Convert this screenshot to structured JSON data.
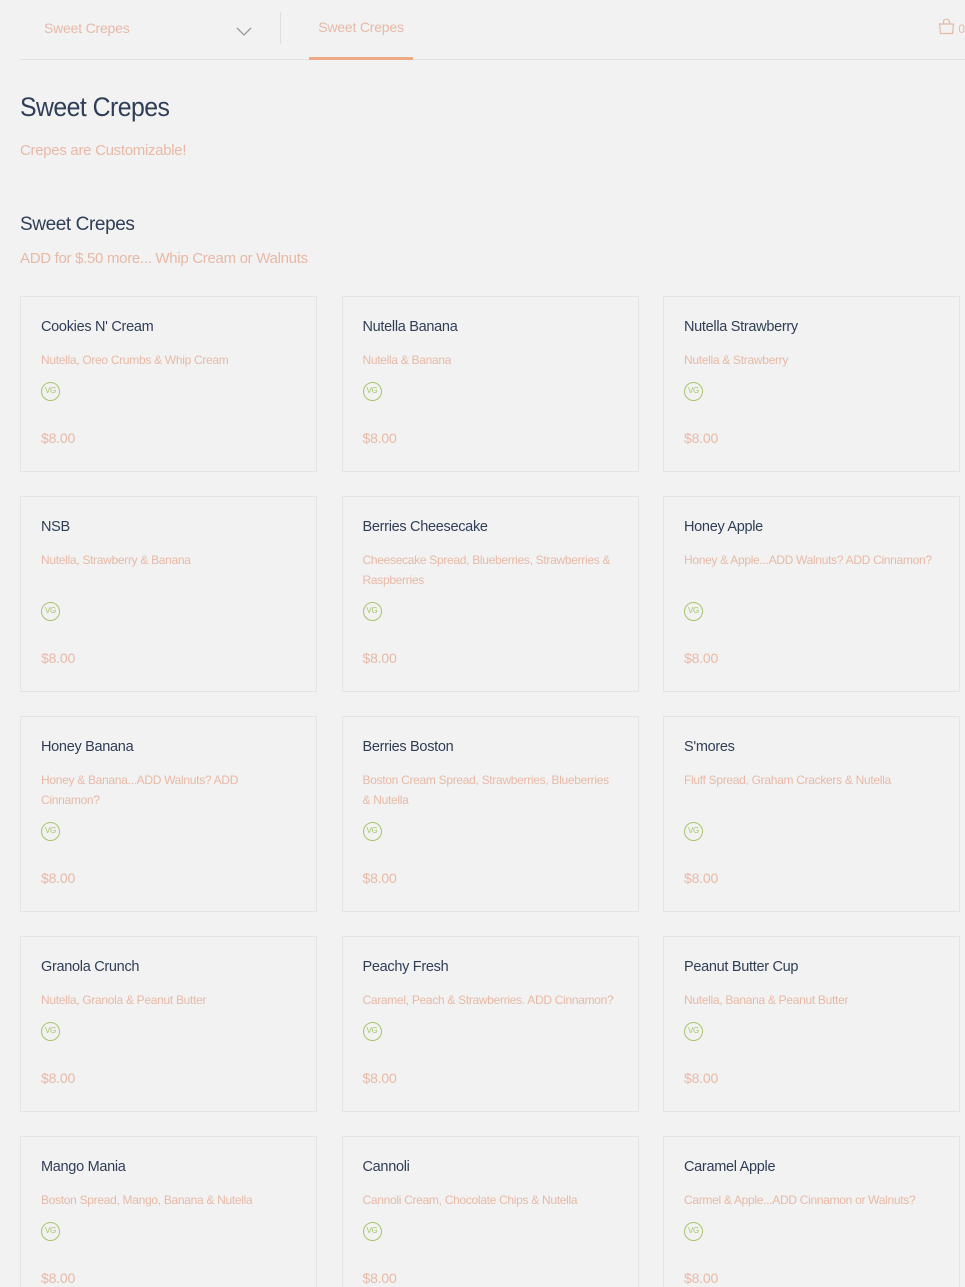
{
  "header": {
    "menu_select_label": "Sweet Crepes",
    "active_tab": "Sweet Crepes",
    "cart_count": "0"
  },
  "page": {
    "title": "Sweet Crepes",
    "subtitle": "Crepes are Customizable!"
  },
  "section": {
    "title": "Sweet Crepes",
    "subtitle": "ADD for $.50 more... Whip Cream or Walnuts"
  },
  "badge_label": "VG",
  "colors": {
    "accent": "#f0a985",
    "muted_text": "#e7b9a6",
    "heading": "#2f3e56",
    "vegetarian_badge": "#a6c46a",
    "background": "#f2f2f2"
  },
  "items": [
    {
      "name": "Cookies N' Cream",
      "description": "Nutella, Oreo Crumbs & Whip Cream",
      "price": "$8.00"
    },
    {
      "name": "Nutella Banana",
      "description": "Nutella & Banana",
      "price": "$8.00"
    },
    {
      "name": "Nutella Strawberry",
      "description": "Nutella & Strawberry",
      "price": "$8.00"
    },
    {
      "name": "NSB",
      "description": "Nutella, Strawberry & Banana",
      "price": "$8.00"
    },
    {
      "name": "Berries Cheesecake",
      "description": "Cheesecake Spread, Blueberries, Strawberries & Raspberries",
      "price": "$8.00"
    },
    {
      "name": "Honey Apple",
      "description": "Honey & Apple...ADD Walnuts? ADD Cinnamon?",
      "price": "$8.00"
    },
    {
      "name": "Honey Banana",
      "description": "Honey & Banana...ADD Walnuts? ADD Cinnamon?",
      "price": "$8.00"
    },
    {
      "name": "Berries Boston",
      "description": "Boston Cream Spread, Strawberries, Blueberries & Nutella",
      "price": "$8.00"
    },
    {
      "name": "S'mores",
      "description": "Fluff Spread, Graham Crackers & Nutella",
      "price": "$8.00"
    },
    {
      "name": "Granola Crunch",
      "description": "Nutella, Granola & Peanut Butter",
      "price": "$8.00"
    },
    {
      "name": "Peachy Fresh",
      "description": "Caramel, Peach & Strawberries. ADD Cinnamon?",
      "price": "$8.00"
    },
    {
      "name": "Peanut Butter Cup",
      "description": "Nutella, Banana & Peanut Butter",
      "price": "$8.00"
    },
    {
      "name": "Mango Mania",
      "description": "Boston Spread, Mango, Banana & Nutella",
      "price": "$8.00"
    },
    {
      "name": "Cannoli",
      "description": "Cannoli Cream, Chocolate Chips & Nutella",
      "price": "$8.00"
    },
    {
      "name": "Caramel Apple",
      "description": "Carmel & Apple...ADD Cinnamon or Walnuts?",
      "price": "$8.00"
    }
  ]
}
